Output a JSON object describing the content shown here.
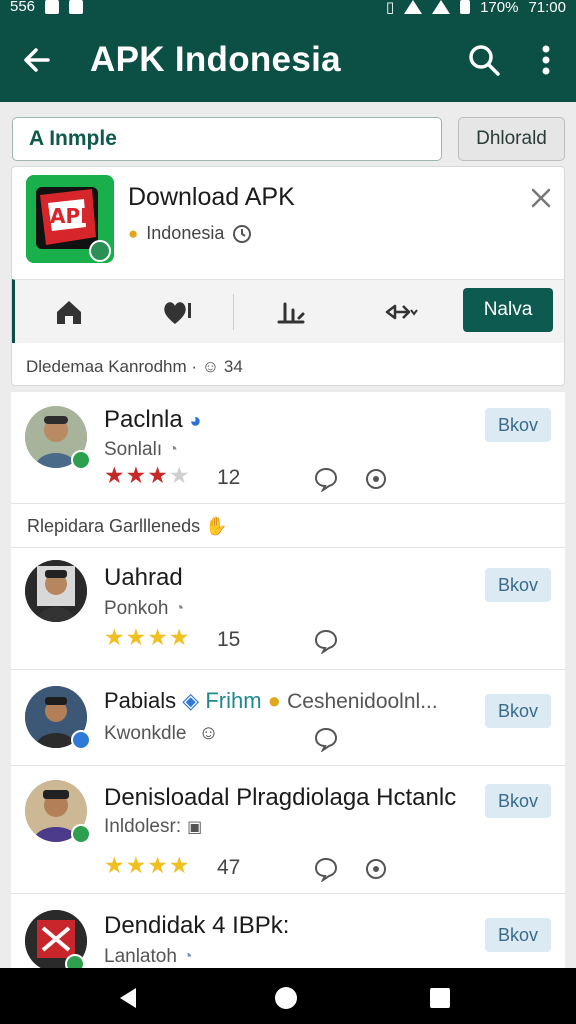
{
  "status_bar": {
    "left_text": "556",
    "battery": "170%",
    "time": "71:00"
  },
  "appbar": {
    "title": "APK Indonesia"
  },
  "search": {
    "value": "A Inmple",
    "button_label": "Dhlorald"
  },
  "card": {
    "title": "Download APK",
    "subtitle": "Indonesia",
    "nav_button": "Nalva",
    "footer_text": "Dledemaa Kanrodhm ·",
    "footer_count": "34"
  },
  "list": {
    "items": [
      {
        "name": "Paclnla",
        "sub": "Sonlalı",
        "rating": 3,
        "count": "12",
        "button": "Bkov"
      },
      {
        "name": "Uahrad",
        "sub": "Ponkoh",
        "rating": 4,
        "count": "15",
        "button": "Bkov"
      },
      {
        "name": "Pabials",
        "tag": "Frihm",
        "extra": "Ceshenidoolnl...",
        "sub": "Kwonkdle",
        "button": "Bkov"
      },
      {
        "name": "Denisloadal Plragdiolaga Hctanlc",
        "sub": "Inldolesr:",
        "rating": 4,
        "count": "47",
        "button": "Bkov"
      },
      {
        "name": "Dendidak 4 IBPk:",
        "sub": "Lanlatoh",
        "button": "Bkov"
      }
    ],
    "section_label": "Rlepidara Garllleneds"
  },
  "colors": {
    "primary": "#0c4f45",
    "star": "#f0c020",
    "star_red": "#c62828",
    "chip": "#dcebf3"
  }
}
